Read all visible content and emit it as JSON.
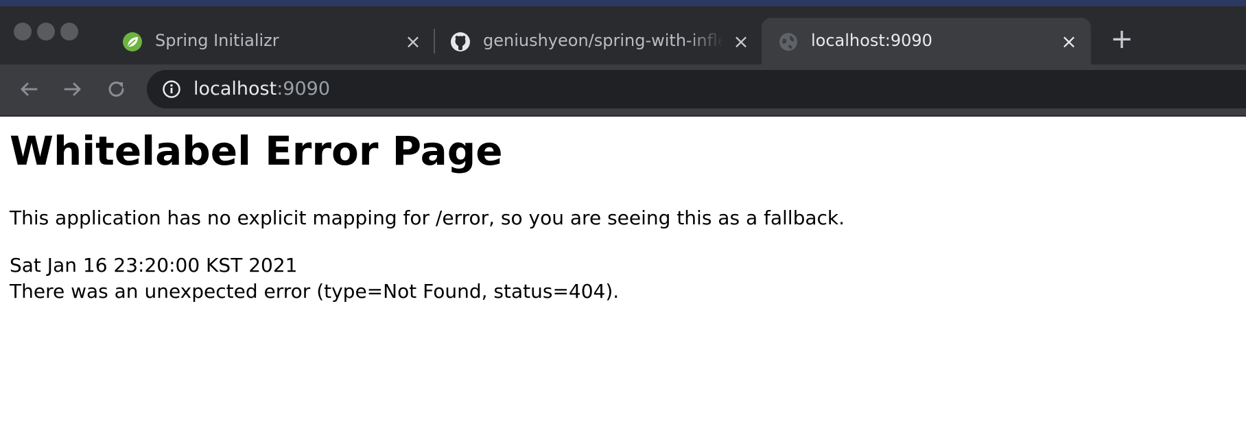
{
  "tabs": [
    {
      "title": "Spring Initializr",
      "icon": "spring-leaf-icon",
      "active": false
    },
    {
      "title": "geniushyeon/spring-with-inflea",
      "icon": "github-icon",
      "active": false
    },
    {
      "title": "localhost:9090",
      "icon": "globe-icon",
      "active": true
    }
  ],
  "toolbar": {
    "url_host": "localhost",
    "url_port": ":9090"
  },
  "page": {
    "heading": "Whitelabel Error Page",
    "message": "This application has no explicit mapping for /error, so you are seeing this as a fallback.",
    "timestamp": "Sat Jan 16 23:20:00 KST 2021",
    "error_detail": "There was an unexpected error (type=Not Found, status=404)."
  },
  "colors": {
    "titlebar": "#2a2b2e",
    "toolbar": "#3c3d40",
    "omnibox": "#202124",
    "spring_green": "#6db33f"
  }
}
